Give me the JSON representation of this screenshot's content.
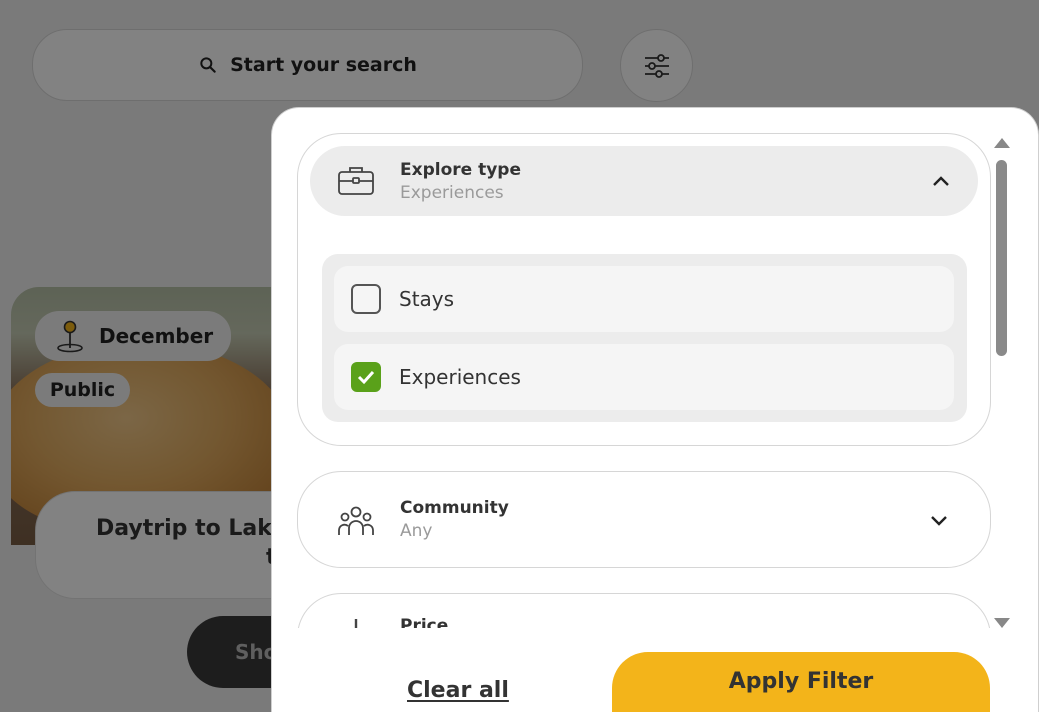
{
  "search": {
    "label": "Start your search"
  },
  "card": {
    "date_badge": "December",
    "visibility_badge": "Public",
    "title_line1": "Daytrip to Lake",
    "title_line2": "t",
    "show_button": "Sho"
  },
  "filter": {
    "explore": {
      "title": "Explore type",
      "value": "Experiences",
      "options": [
        {
          "label": "Stays",
          "checked": false
        },
        {
          "label": "Experiences",
          "checked": true
        }
      ]
    },
    "community": {
      "title": "Community",
      "value": "Any"
    },
    "price": {
      "title": "Price"
    },
    "clear_label": "Clear all",
    "apply_label": "Apply Filter"
  },
  "colors": {
    "accent": "#F3B41A",
    "check": "#5AA11A",
    "overlay": "#7D7D7D"
  },
  "icons": {
    "search": "search-icon",
    "filter": "sliders-icon",
    "location": "map-pin-icon",
    "explore": "briefcase-icon",
    "community": "people-icon",
    "price": "plus-icon"
  }
}
